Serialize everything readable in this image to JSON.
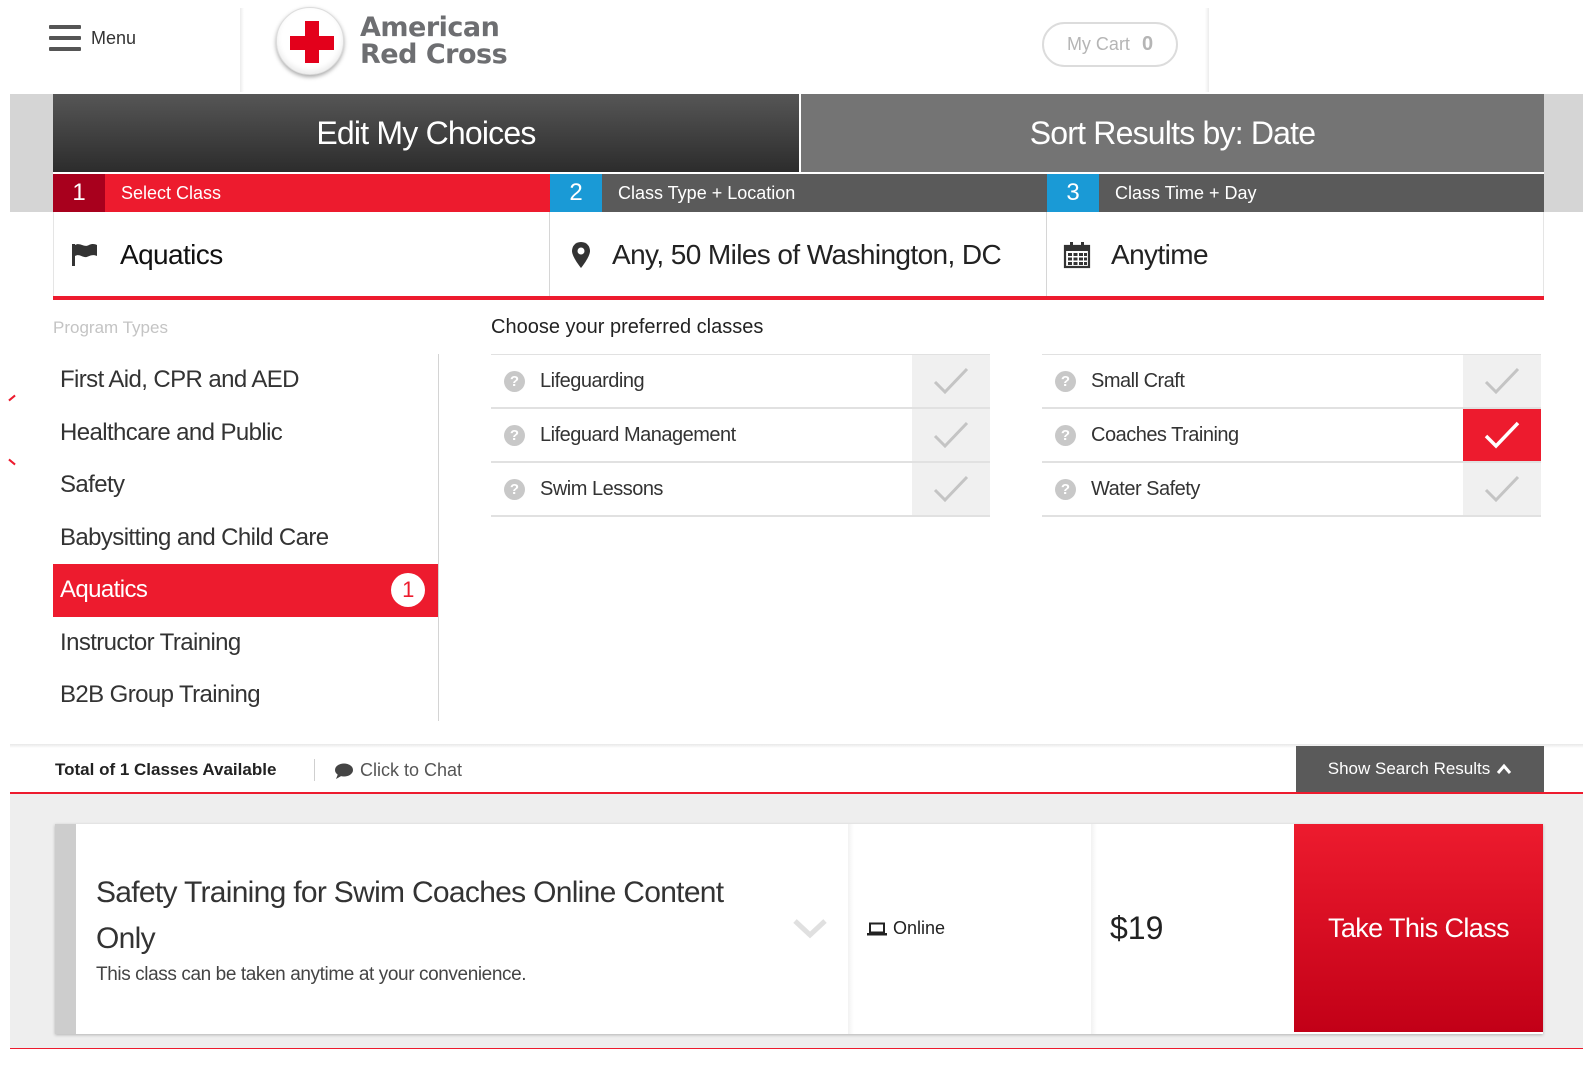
{
  "header": {
    "menu_label": "Menu",
    "logo_line1": "American",
    "logo_line2": "Red Cross",
    "cart_label": "My Cart",
    "cart_count": "0"
  },
  "filter_bar": {
    "edit_choices": "Edit My Choices",
    "sort_results": "Sort Results by: Date",
    "steps": [
      {
        "num": "1",
        "label": "Select Class",
        "value": "Aquatics",
        "icon": "flag-icon"
      },
      {
        "num": "2",
        "label": "Class Type + Location",
        "value": "Any, 50 Miles of Washington, DC",
        "icon": "map-marker-icon"
      },
      {
        "num": "3",
        "label": "Class Time + Day",
        "value": "Anytime",
        "icon": "calendar-icon"
      }
    ]
  },
  "program_types": {
    "heading": "Program Types",
    "items": [
      {
        "label": "First Aid, CPR and AED"
      },
      {
        "label": "Healthcare and Public"
      },
      {
        "label": "Safety"
      },
      {
        "label": "Babysitting and Child Care"
      },
      {
        "label": "Aquatics",
        "badge": "1",
        "active": true
      },
      {
        "label": "Instructor Training"
      },
      {
        "label": "B2B Group Training"
      }
    ]
  },
  "preferred_classes": {
    "heading": "Choose your preferred classes",
    "column1": [
      {
        "label": "Lifeguarding",
        "checked": false
      },
      {
        "label": "Lifeguard Management",
        "checked": false
      },
      {
        "label": "Swim Lessons",
        "checked": false
      }
    ],
    "column2": [
      {
        "label": "Small Craft",
        "checked": false
      },
      {
        "label": "Coaches Training",
        "checked": true
      },
      {
        "label": "Water Safety",
        "checked": false
      }
    ]
  },
  "results": {
    "total": "Total of 1 Classes Available",
    "chat": "Click to Chat",
    "show_results": "Show Search Results"
  },
  "class_card": {
    "title": "Safety Training for Swim Coaches Online Content Only",
    "description": "This class can be taken anytime at your convenience.",
    "format": "Online",
    "price": "$19",
    "cta": "Take This Class"
  },
  "colors": {
    "brand_red": "#ed1b2e",
    "step_blue": "#1a9ad6",
    "dark_grey": "#5a5a5a"
  }
}
